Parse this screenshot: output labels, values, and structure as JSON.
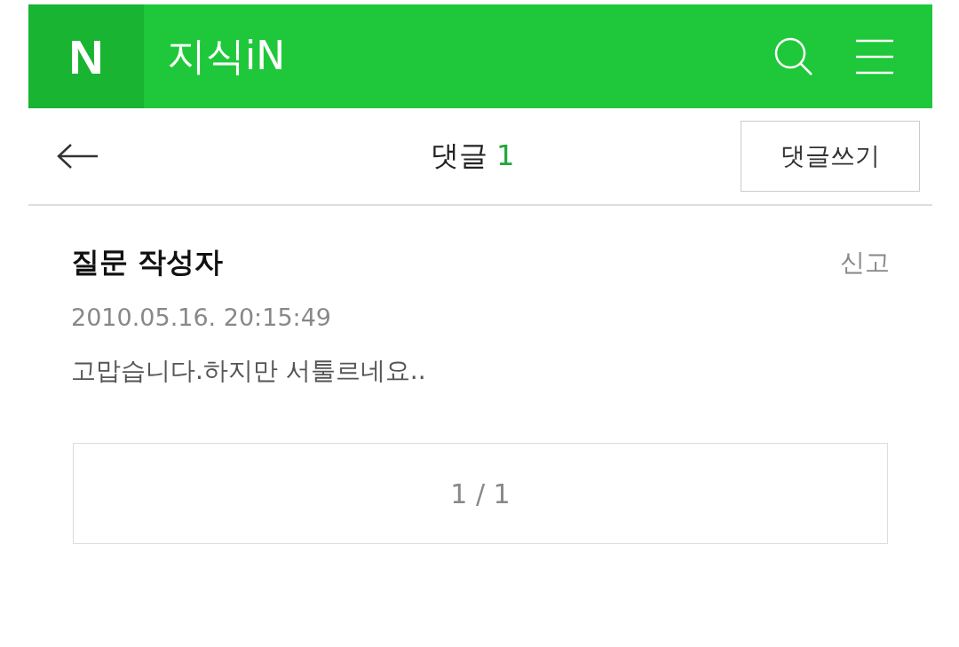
{
  "header": {
    "logo": "N",
    "title": "지식iN"
  },
  "toolbar": {
    "title": "댓글",
    "count": "1",
    "write_button": "댓글쓰기"
  },
  "comments": [
    {
      "author": "질문 작성자",
      "report": "신고",
      "date": "2010.05.16. 20:15:49",
      "text": "고맙습니다.하지만 서툴르네요.."
    }
  ],
  "pagination": "1 / 1"
}
